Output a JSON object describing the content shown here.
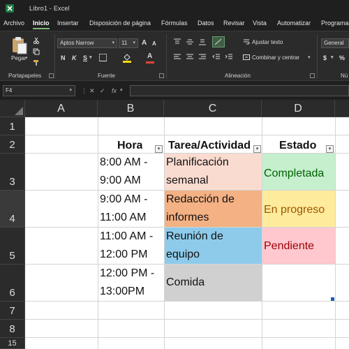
{
  "titlebar": {
    "title": "Libro1  -  Excel",
    "app_icon": "excel-logo-icon"
  },
  "menu": {
    "tabs": [
      {
        "label": "Archivo",
        "active": false
      },
      {
        "label": "Inicio",
        "active": true
      },
      {
        "label": "Insertar",
        "active": false
      },
      {
        "label": "Disposición de página",
        "active": false
      },
      {
        "label": "Fórmulas",
        "active": false
      },
      {
        "label": "Datos",
        "active": false
      },
      {
        "label": "Revisar",
        "active": false
      },
      {
        "label": "Vista",
        "active": false
      },
      {
        "label": "Automatizar",
        "active": false
      },
      {
        "label": "Programa",
        "active": false
      }
    ]
  },
  "ribbon": {
    "clipboard": {
      "paste_label": "Pegar",
      "group_label": "Portapapeles"
    },
    "font": {
      "font_name": "Aptos Narrow",
      "font_size": "11",
      "bold": "N",
      "italic": "K",
      "underline": "S",
      "grow": "A",
      "shrink": "A",
      "font_color_glyph": "A",
      "group_label": "Fuente",
      "font_color": "#e0443a",
      "fill_color": "#f5d90a"
    },
    "alignment": {
      "wrap_text": "Ajustar texto",
      "merge_center": "Combinar y centrar",
      "group_label": "Alineación"
    },
    "number": {
      "format": "General",
      "currency": "$",
      "percent": "%",
      "group_label": "Nú"
    }
  },
  "formula_bar": {
    "name_box": "F4",
    "fx": "fx",
    "cancel": "✕",
    "confirm": "✓",
    "formula": ""
  },
  "grid": {
    "columns": [
      "A",
      "B",
      "C",
      "D"
    ],
    "rows": [
      "1",
      "2",
      "3",
      "4",
      "5",
      "6",
      "7",
      "8"
    ],
    "partial_row": "15",
    "headers": {
      "hora": "Hora",
      "tarea": "Tarea/Actividad",
      "estado": "Estado"
    },
    "filter_glyph": "▾",
    "entries": [
      {
        "hora1": "8:00 AM -",
        "hora2": "9:00 AM",
        "tarea1": "Planificación",
        "tarea2": "semanal",
        "estado": "Completada",
        "tarea_fill": "#fadbd0",
        "estado_fill": "#c6efce",
        "estado_color": "#006100"
      },
      {
        "hora1": "9:00 AM -",
        "hora2": "11:00 AM",
        "tarea1": "Redacción de",
        "tarea2": "informes",
        "estado": "En progreso",
        "tarea_fill": "#f4b183",
        "estado_fill": "#ffeb9c",
        "estado_color": "#9c5700"
      },
      {
        "hora1": "11:00 AM -",
        "hora2": "12:00 PM",
        "tarea1": "Reunión de",
        "tarea2": "equipo",
        "estado": "Pendiente",
        "tarea_fill": "#8ecbeb",
        "estado_fill": "#ffc7ce",
        "estado_color": "#9c0006"
      },
      {
        "hora1": "12:00 PM -",
        "hora2": "13:00PM",
        "tarea1": "Comida",
        "tarea2": "",
        "estado": "",
        "tarea_fill": "#d0d0d0",
        "estado_fill": "#ffffff",
        "estado_color": "#000000"
      }
    ]
  }
}
